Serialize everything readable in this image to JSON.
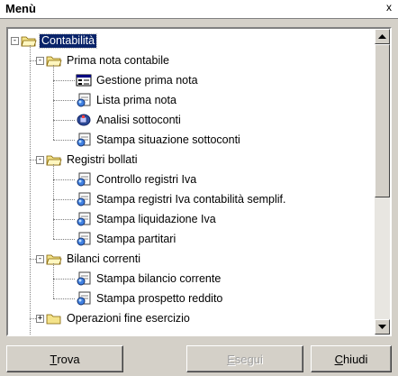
{
  "window": {
    "title": "Menù",
    "close_glyph": "x"
  },
  "tree": {
    "root": {
      "label": "Contabilità",
      "expanded": true,
      "selected": true
    },
    "groups": [
      {
        "label": "Prima nota contabile",
        "expanded": true,
        "items": [
          {
            "label": "Gestione prima nota",
            "icon": "form-icon"
          },
          {
            "label": "Lista prima nota",
            "icon": "report-icon"
          },
          {
            "label": "Analisi sottoconti",
            "icon": "analysis-icon"
          },
          {
            "label": "Stampa situazione sottoconti",
            "icon": "report-icon"
          }
        ]
      },
      {
        "label": "Registri bollati",
        "expanded": true,
        "items": [
          {
            "label": "Controllo registri Iva",
            "icon": "report-icon"
          },
          {
            "label": "Stampa registri Iva contabilità semplif.",
            "icon": "report-icon"
          },
          {
            "label": "Stampa liquidazione Iva",
            "icon": "report-icon"
          },
          {
            "label": "Stampa partitari",
            "icon": "report-icon"
          }
        ]
      },
      {
        "label": "Bilanci correnti",
        "expanded": true,
        "items": [
          {
            "label": "Stampa bilancio corrente",
            "icon": "report-icon"
          },
          {
            "label": "Stampa prospetto reddito",
            "icon": "report-icon"
          }
        ]
      },
      {
        "label": "Operazioni fine esercizio",
        "expanded": false,
        "items": []
      }
    ]
  },
  "buttons": {
    "find": {
      "first": "T",
      "rest": "rova"
    },
    "run": {
      "first": "E",
      "rest": "segui",
      "disabled": true
    },
    "close": {
      "first": "C",
      "rest": "hiudi"
    }
  },
  "colors": {
    "selection": "#0a246a",
    "folder": "#f4e38a",
    "face": "#d4d0c8"
  }
}
